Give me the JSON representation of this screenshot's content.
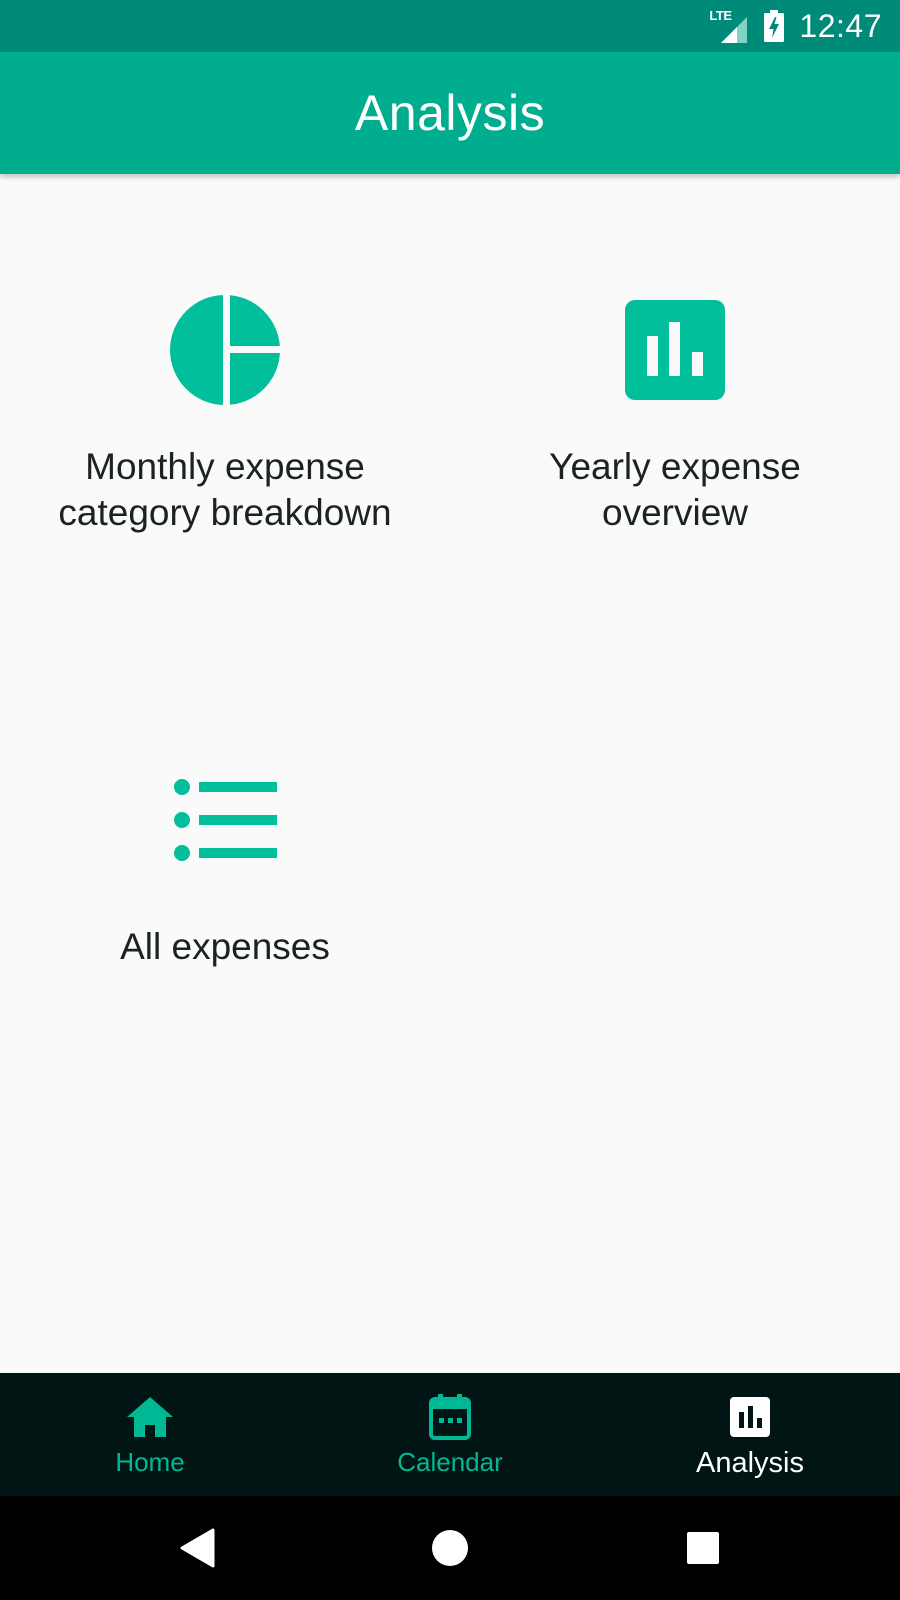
{
  "status_bar": {
    "network": "LTE",
    "time": "12:47"
  },
  "app_bar": {
    "title": "Analysis"
  },
  "tiles": [
    {
      "label": "Monthly expense\ncategory breakdown",
      "icon": "pie-chart-icon"
    },
    {
      "label": "Yearly expense\noverview",
      "icon": "bar-chart-icon"
    },
    {
      "label": "All expenses",
      "icon": "list-icon"
    }
  ],
  "bottom_nav": {
    "items": [
      {
        "label": "Home",
        "icon": "home-icon",
        "active": false
      },
      {
        "label": "Calendar",
        "icon": "calendar-icon",
        "active": false
      },
      {
        "label": "Analysis",
        "icon": "bar-chart-icon",
        "active": true
      }
    ]
  },
  "colors": {
    "status_bar": "#008a78",
    "app_bar": "#00ae8f",
    "accent": "#00bf9a",
    "nav_background": "#001514",
    "background": "#fafafa"
  }
}
